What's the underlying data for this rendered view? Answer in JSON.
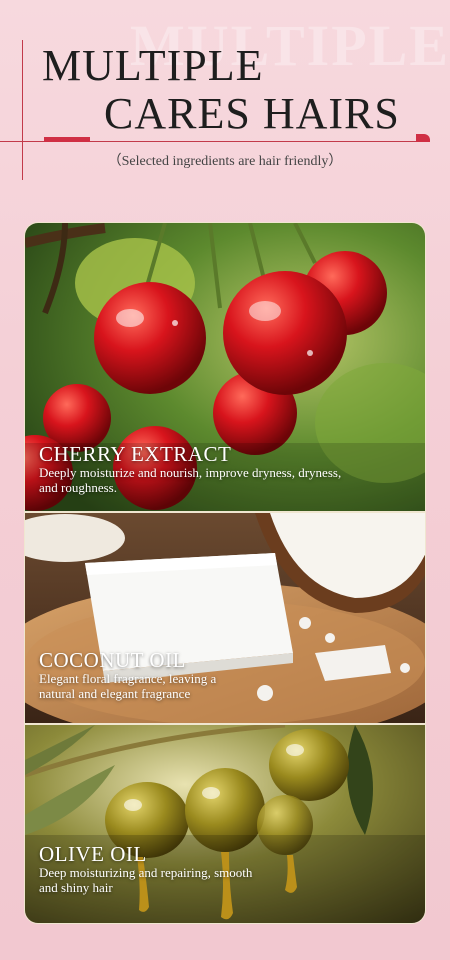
{
  "header": {
    "watermark": "MULTIPLE",
    "title_line1": "MULTIPLE",
    "title_line2": "CARES HAIRS",
    "subtitle": "（Selected ingredients are hair friendly）"
  },
  "ingredients": [
    {
      "title": "CHERRY EXTRACT",
      "description": "Deeply moisturize and nourish, improve dryness, dryness, and roughness.",
      "image": "cherries-photo"
    },
    {
      "title": "COCONUT OIL",
      "description": "Elegant floral fragrance, leaving a natural and elegant fragrance",
      "image": "coconut-soap-photo"
    },
    {
      "title": "OLIVE OIL",
      "description": "Deep moisturizing and repairing, smooth and shiny hair",
      "image": "olives-photo"
    }
  ],
  "colors": {
    "accent": "#d02f44",
    "background": "#f4cfd6",
    "title_text": "#1e1e1e"
  }
}
